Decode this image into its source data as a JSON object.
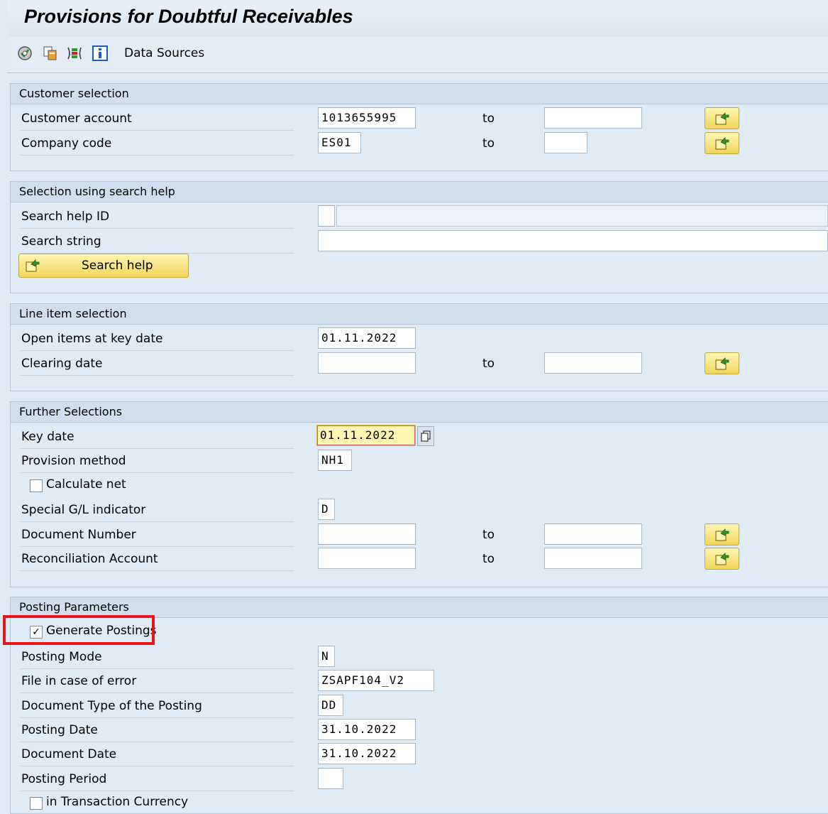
{
  "title": "Provisions for Doubtful Receivables",
  "toolbar": {
    "icons": [
      "execute-icon",
      "copy-variant-icon",
      "selection-options-icon",
      "info-icon"
    ],
    "data_sources_label": "Data Sources"
  },
  "customer_selection": {
    "header": "Customer selection",
    "customer_account": {
      "label": "Customer account",
      "value": "1013655995",
      "to_label": "to",
      "to_value": ""
    },
    "company_code": {
      "label": "Company code",
      "value": "ES01",
      "to_label": "to",
      "to_value": ""
    }
  },
  "search_help_selection": {
    "header": "Selection using search help",
    "search_help_id": {
      "label": "Search help ID",
      "value": "",
      "description": ""
    },
    "search_string": {
      "label": "Search string",
      "value": ""
    },
    "search_help_button": "Search help"
  },
  "line_item_selection": {
    "header": "Line item selection",
    "open_items_key_date": {
      "label": "Open items at key date",
      "value": "01.11.2022"
    },
    "clearing_date": {
      "label": "Clearing date",
      "value": "",
      "to_label": "to",
      "to_value": ""
    }
  },
  "further_selections": {
    "header": "Further Selections",
    "key_date": {
      "label": "Key date",
      "value": "01.11.2022"
    },
    "provision_method": {
      "label": "Provision method",
      "value": "NH1"
    },
    "calculate_net": {
      "label": "Calculate net",
      "checked": false
    },
    "special_gl_indicator": {
      "label": "Special G/L indicator",
      "value": "D"
    },
    "document_number": {
      "label": "Document Number",
      "value": "",
      "to_label": "to",
      "to_value": ""
    },
    "reconciliation_account": {
      "label": "Reconciliation Account",
      "value": "",
      "to_label": "to",
      "to_value": ""
    }
  },
  "posting_parameters": {
    "header": "Posting Parameters",
    "generate_postings": {
      "label": "Generate Postings",
      "checked": true,
      "mark": "✓"
    },
    "posting_mode": {
      "label": "Posting Mode",
      "value": "N"
    },
    "file_in_case_of_error": {
      "label": "File in case of error",
      "value": "ZSAPF104_V2"
    },
    "document_type": {
      "label": "Document Type of the Posting",
      "value": "DD"
    },
    "posting_date": {
      "label": "Posting Date",
      "value": "31.10.2022"
    },
    "document_date": {
      "label": "Document Date",
      "value": "31.10.2022"
    },
    "posting_period": {
      "label": "Posting Period",
      "value": ""
    },
    "in_transaction_currency": {
      "label": "in Transaction Currency",
      "checked": false
    }
  },
  "colors": {
    "background": "#dfebf5",
    "group_header": "#cfdfef",
    "button_yellow": "#f3d55a",
    "highlight_red": "#e8141b",
    "focus_field": "#fff5b0"
  }
}
